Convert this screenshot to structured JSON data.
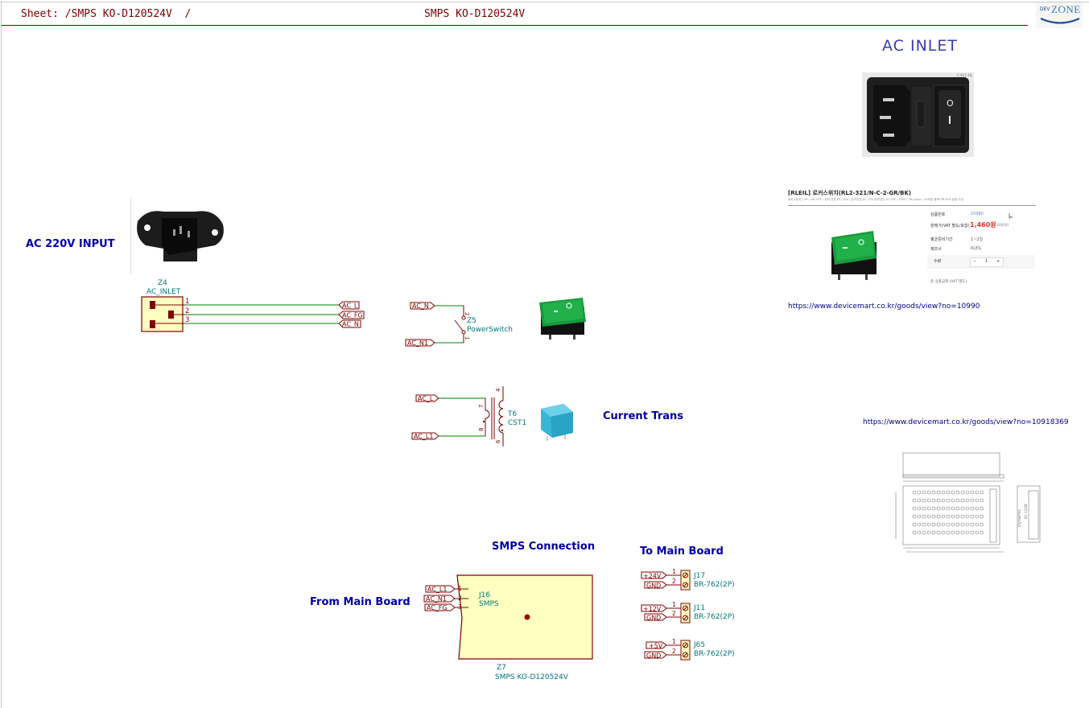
{
  "header": {
    "sheet_label": "Sheet: /SMPS KO-D120524V  /",
    "sheet_title": "SMPS KO-D120524V",
    "logo_small": "DEV",
    "logo_big": "ZONE"
  },
  "sections": {
    "ac_inlet_title": "AC INLET",
    "ac_input_title": "AC 220V INPUT",
    "current_trans_title": "Current Trans",
    "smps_connection_title": "SMPS Connection",
    "to_main_board_title": "To Main Board",
    "from_main_board_title": "From Main Board"
  },
  "colors": {
    "wire": "#008000",
    "symbol": "#800000",
    "body_fill": "#ffffc2",
    "ref_text": "#007878",
    "title_text": "#0000a0"
  },
  "components": {
    "z4": {
      "ref": "Z4",
      "value": "AC_INLET",
      "pins": [
        "1",
        "2",
        "3"
      ],
      "nets": [
        "AC_L",
        "AC_FG",
        "AC_N"
      ]
    },
    "z5": {
      "ref": "Z5",
      "value": "PowerSwitch",
      "pins": [
        "2",
        "1"
      ],
      "nets": [
        "AC_N",
        "AC_N1"
      ]
    },
    "t6": {
      "ref": "T6",
      "value": "CST1",
      "pins": [
        "4",
        "7",
        "8",
        "6"
      ],
      "nets": [
        "AC_L",
        "AC_L1"
      ]
    },
    "j16": {
      "ref": "J16",
      "value": "SMPS",
      "pins": [
        "1",
        "2",
        "3"
      ],
      "nets": [
        "AC_L1",
        "AC_N1",
        "AC_FG"
      ]
    },
    "z7": {
      "ref": "Z7",
      "value": "SMPS KO-D120524V"
    },
    "connectors": [
      {
        "ref": "J17",
        "value": "BR-762(2P)",
        "pins": [
          "1",
          "2"
        ],
        "nets": [
          "+24V",
          "GND"
        ]
      },
      {
        "ref": "J11",
        "value": "BR-762(2P)",
        "pins": [
          "1",
          "2"
        ],
        "nets": [
          "+12V",
          "GND"
        ]
      },
      {
        "ref": "J65",
        "value": "BR-762(2P)",
        "pins": [
          "1",
          "2"
        ],
        "nets": [
          "+5V",
          "GND"
        ]
      }
    ]
  },
  "product_card": {
    "title": "[RLEIL] 로커스위치(RL2-321/N-C-2-GR/BK)",
    "subtitle": "로커스위치 / 4P / ON-OFF / 정격 전류 6A, 10A / 정격전압-AC 125 정격전압-AC 250 / DPST / W/Lamp / 10파장 블랙스펙 녹색 발광 다임",
    "rows": [
      {
        "label": "상품번호",
        "value": "10990"
      },
      {
        "label": "판매가(VAT 별도/포함)",
        "value": "1,460원",
        "extra": "(1,606원)"
      },
      {
        "label": "평균준비기간",
        "value": "1~2일"
      },
      {
        "label": "제조사",
        "value": "RLEIL"
      }
    ],
    "quantity_label": "수량",
    "quantity_value": "1",
    "qty_minus": "−",
    "qty_plus": "+",
    "total_label": "총 상품금액 (VAT 별도)"
  },
  "links": {
    "switch_url": "https://www.devicemart.co.kr/goods/view?no=10990",
    "smps_url": "https://www.devicemart.co.kr/goods/view?no=10918369"
  },
  "images": {
    "ac_inlet_switch_photo": "ac-inlet-with-switch-photo",
    "ac_inlet_photo": "iec-c14-inlet-photo",
    "rocker_switch_photo": "green-rocker-switch-photo",
    "current_transformer_photo": "current-transformer-photo",
    "smps_drawing": "smps-mechanical-drawing",
    "photo_label": "C-811-18",
    "drawing_brand": "Dynamic",
    "drawing_model": "KO-120W"
  }
}
